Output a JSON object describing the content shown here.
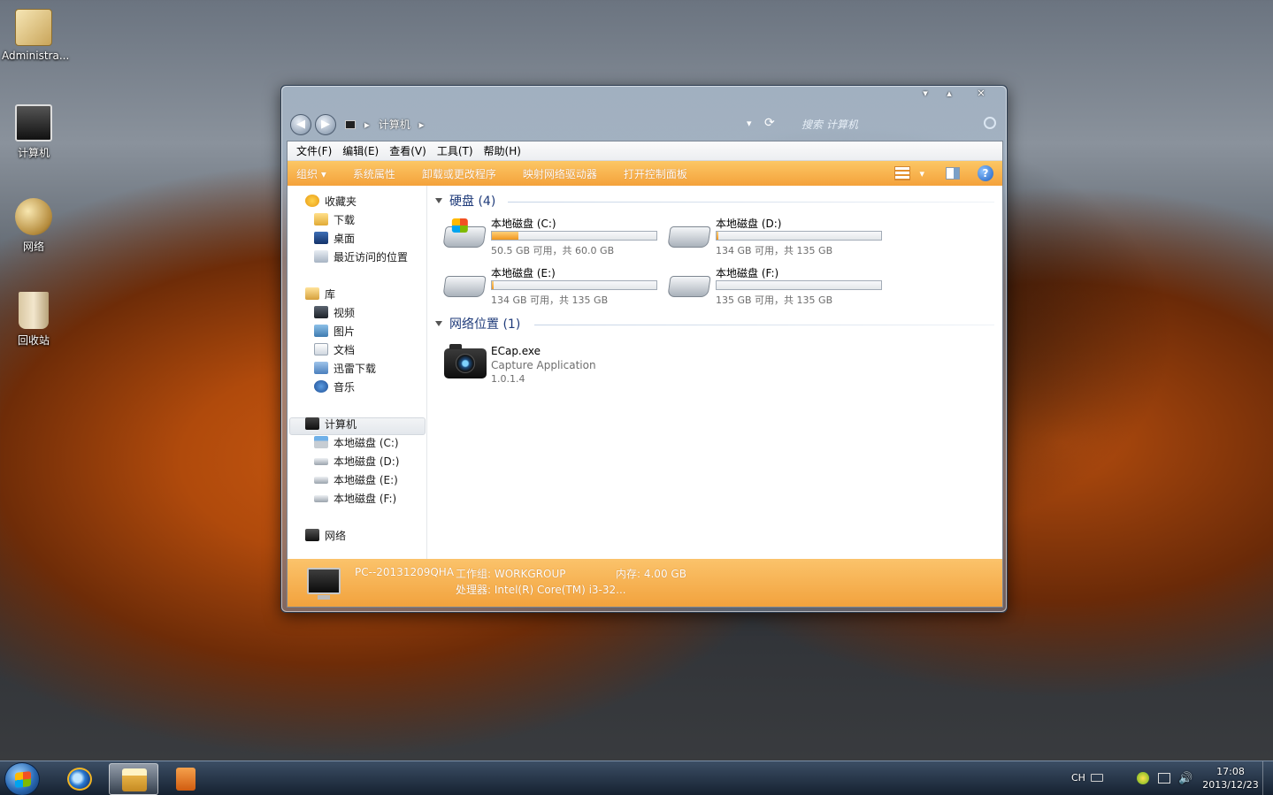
{
  "desktop": {
    "icons": [
      {
        "label": "Administra..."
      },
      {
        "label": "计算机"
      },
      {
        "label": "网络"
      },
      {
        "label": "回收站"
      }
    ]
  },
  "window": {
    "controls": {
      "minimize": "▾",
      "maximize": "▴",
      "close": "✕"
    },
    "nav": {
      "back": "◀",
      "forward": "▶"
    },
    "address": {
      "root_glyph": "▸",
      "location": "计算机",
      "sep": "▸",
      "dropdown": "▾",
      "refresh": "⟳"
    },
    "search": {
      "placeholder": "搜索 计算机"
    },
    "menu": [
      "文件(F)",
      "编辑(E)",
      "查看(V)",
      "工具(T)",
      "帮助(H)"
    ],
    "commands": {
      "organize": "组织 ▾",
      "system_properties": "系统属性",
      "uninstall": "卸载或更改程序",
      "map_drive": "映射网络驱动器",
      "control_panel": "打开控制面板",
      "view_arrow": "▾",
      "help": "?"
    },
    "sidebar": {
      "favorites": "收藏夹",
      "downloads": "下载",
      "desktop": "桌面",
      "recent": "最近访问的位置",
      "libraries": "库",
      "videos": "视频",
      "pictures": "图片",
      "documents": "文档",
      "thunder": "迅雷下载",
      "music": "音乐",
      "computer": "计算机",
      "drive_c": "本地磁盘 (C:)",
      "drive_d": "本地磁盘 (D:)",
      "drive_e": "本地磁盘 (E:)",
      "drive_f": "本地磁盘 (F:)",
      "network": "网络"
    },
    "groups": {
      "hard_disks": "硬盘 (4)",
      "network_locations": "网络位置 (1)"
    },
    "drives": [
      {
        "name": "本地磁盘 (C:)",
        "info": "50.5 GB 可用，共 60.0 GB",
        "used_fraction": 0.16
      },
      {
        "name": "本地磁盘 (D:)",
        "info": "134 GB 可用，共 135 GB",
        "used_fraction": 0.01
      },
      {
        "name": "本地磁盘 (E:)",
        "info": "134 GB 可用，共 135 GB",
        "used_fraction": 0.01
      },
      {
        "name": "本地磁盘 (F:)",
        "info": "135 GB 可用，共 135 GB",
        "used_fraction": 0.0
      }
    ],
    "network_item": {
      "name": "ECap.exe",
      "desc": "Capture Application",
      "version": "1.0.1.4"
    },
    "details": {
      "pc_name": "PC--20131209QHA",
      "workgroup": "工作组: WORKGROUP",
      "memory": "内存: 4.00 GB",
      "processor": "处理器: Intel(R) Core(TM) i3-32..."
    }
  },
  "taskbar": {
    "lang": "CH",
    "time": "17:08",
    "date": "2013/12/23"
  },
  "colors": {
    "accent": "#f4a23b",
    "group_header": "#1f3b7a"
  }
}
